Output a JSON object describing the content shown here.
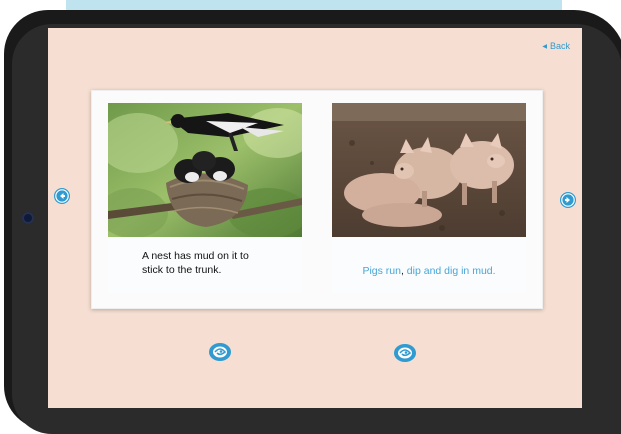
{
  "header": {
    "back_label": "Back"
  },
  "book": {
    "left_page": {
      "caption_line1": "A nest has mud on it to",
      "caption_line2": "stick to the trunk."
    },
    "right_page": {
      "caption_part1": "Pigs run",
      "caption_comma": ",",
      "caption_part2": " dip and dig in mud."
    }
  },
  "icons": {
    "prev": "arrow-left-icon",
    "next": "arrow-right-icon",
    "audio": "ear-icon",
    "back": "triangle-left-icon"
  },
  "colors": {
    "accent": "#2f9bd0",
    "screen_bg": "#f6dfd2",
    "highlight_text": "#4aa6d6"
  }
}
